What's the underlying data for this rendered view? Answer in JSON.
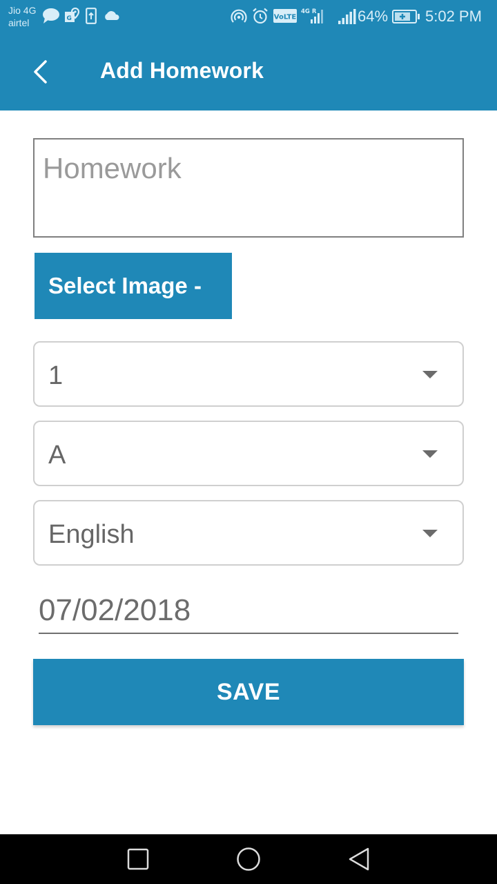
{
  "status_bar": {
    "carrier_top": "Jio 4G",
    "carrier_bottom": "airtel",
    "left_icons": [
      "message-icon",
      "maps-icon",
      "upload-icon",
      "cloud-icon"
    ],
    "right_icons": [
      "hotspot-icon",
      "alarm-icon",
      "volte-icon",
      "signal-4g-icon",
      "signal-icon",
      "battery-charging-icon"
    ],
    "volte_label": "VoLTE",
    "network_label": "4G R",
    "battery": "64%",
    "time": "5:02 PM"
  },
  "app_bar": {
    "title": "Add Homework",
    "back_icon": "chevron-left-icon"
  },
  "form": {
    "homework": {
      "value": "",
      "placeholder": "Homework"
    },
    "select_image_label": "Select Image -",
    "class_dropdown": {
      "selected": "1"
    },
    "section_dropdown": {
      "selected": "A"
    },
    "subject_dropdown": {
      "selected": "English"
    },
    "date": "07/02/2018",
    "save_label": "SAVE"
  },
  "nav_bar": {
    "buttons": [
      "recents-icon",
      "home-icon",
      "back-icon"
    ]
  },
  "colors": {
    "primary": "#1f88b7",
    "text_muted": "#666666",
    "placeholder": "#9a9a9a",
    "border": "#cfcfcf"
  }
}
